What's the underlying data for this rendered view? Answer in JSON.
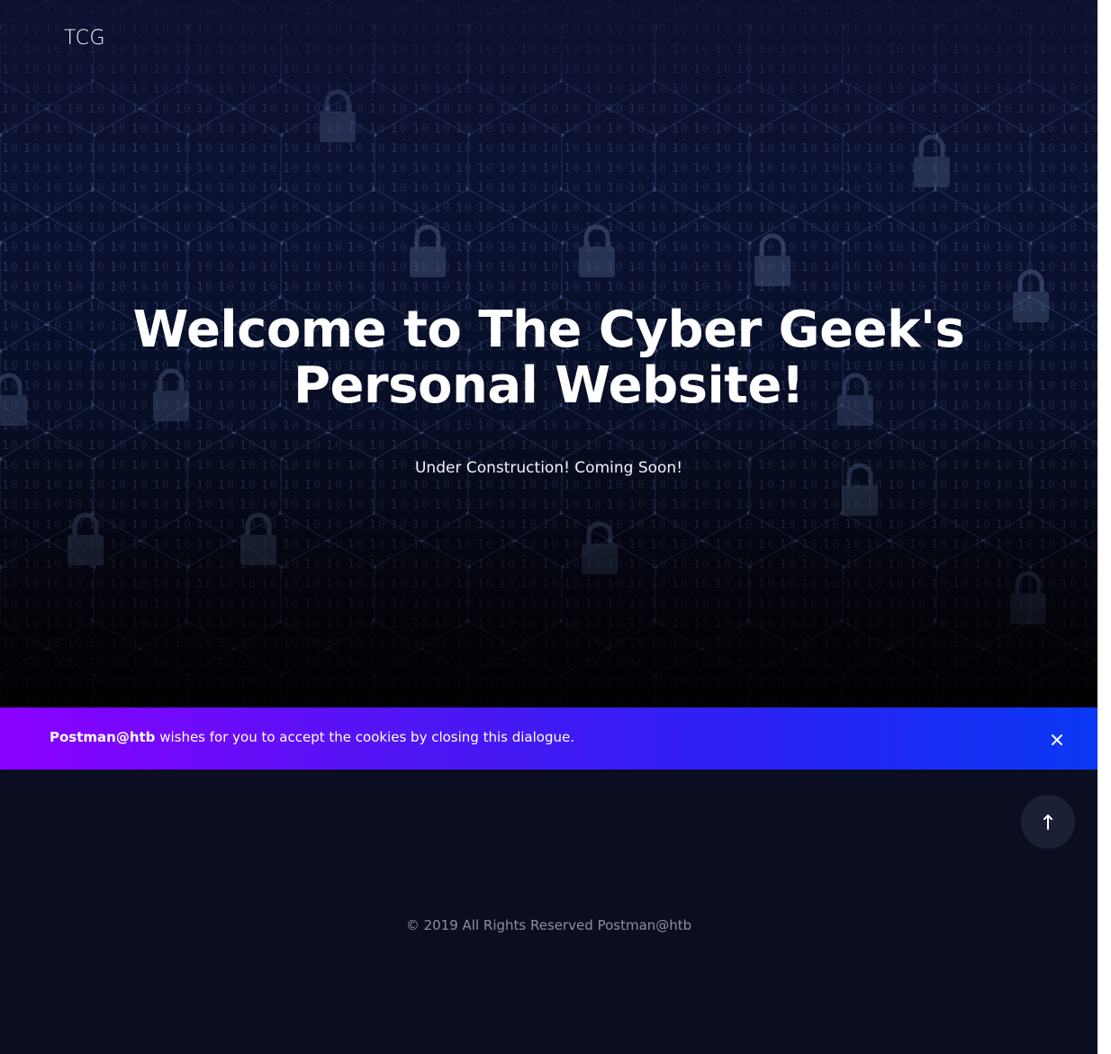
{
  "header": {
    "brand": "TCG"
  },
  "hero": {
    "title_line1": "Welcome to The Cyber Geek's",
    "title_line2": "Personal Website!",
    "subtitle": "Under Construction! Coming Soon!"
  },
  "cookie_notice": {
    "name": "Postman@htb",
    "message": " wishes for you to accept the cookies by closing this dialogue.",
    "close_icon": "close-icon"
  },
  "footer": {
    "to_top_icon": "arrow-up-icon",
    "copyright": "© 2019 All Rights Reserved Postman@htb"
  },
  "colors": {
    "page_background": "#0b0e21",
    "cookie_gradient_start": "#8b00ff",
    "cookie_gradient_end": "#0a38f5",
    "to_top_button": "#1b2036",
    "footer_text": "#8c8fa3"
  }
}
